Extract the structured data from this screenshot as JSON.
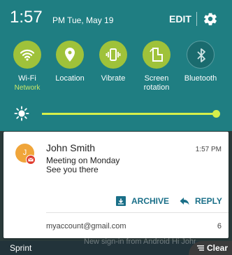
{
  "status": {
    "time": "1:57",
    "ampm_date": "PM Tue, May 19",
    "edit_label": "EDIT",
    "settings_icon": "gear-icon"
  },
  "quick_settings": [
    {
      "label": "Wi-Fi",
      "sublabel": "Network",
      "icon": "wifi-icon",
      "state": "on"
    },
    {
      "label": "Location",
      "sublabel": "",
      "icon": "location-icon",
      "state": "on"
    },
    {
      "label": "Vibrate",
      "sublabel": "",
      "icon": "vibrate-icon",
      "state": "on"
    },
    {
      "label": "Screen rotation",
      "sublabel": "",
      "icon": "screen-rotation-icon",
      "state": "on"
    },
    {
      "label": "Bluetooth",
      "sublabel": "",
      "icon": "bluetooth-icon",
      "state": "off"
    }
  ],
  "brightness": {
    "icon": "brightness-icon",
    "level": 1.0
  },
  "notification": {
    "avatar_letter": "J",
    "sender": "John Smith",
    "time": "1:57 PM",
    "subject": "Meeting on Monday",
    "snippet": "See you there",
    "actions": [
      {
        "label": "ARCHIVE",
        "icon": "archive-icon"
      },
      {
        "label": "REPLY",
        "icon": "reply-icon"
      }
    ],
    "account": "myaccount@gmail.com",
    "count": "6"
  },
  "bottom": {
    "carrier": "Sprint",
    "behind_text": "New sign-in from Android Hi John,",
    "clear_label": "Clear"
  },
  "colors": {
    "shade": "#1f7e82",
    "toggle_on": "#9fc23a",
    "slider": "#d6ef4a",
    "action": "#1a6f88",
    "avatar": "#f0a53a",
    "gmail_badge": "#e03a2c"
  }
}
